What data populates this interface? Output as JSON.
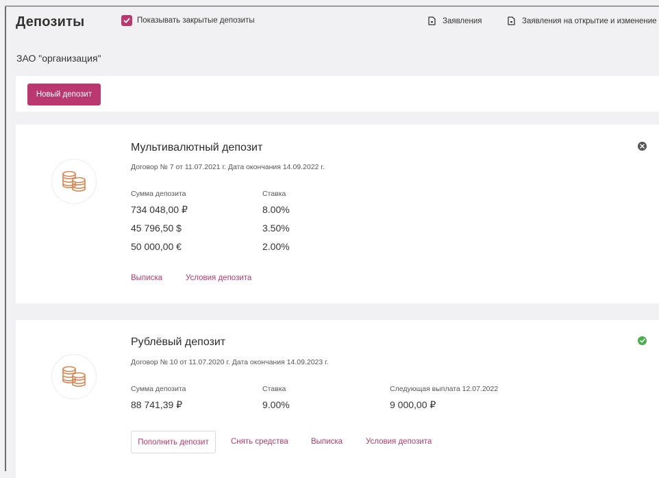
{
  "header": {
    "title": "Депозиты",
    "show_closed_label": "Показывать закрытые депозиты",
    "show_closed_checked": true,
    "link_statements": "Заявления",
    "link_open_change": "Заявления на открытие и изменение"
  },
  "organization": "ЗАО \"организация\"",
  "toolbar": {
    "new_deposit_label": "Новый депозит"
  },
  "colors": {
    "accent": "#b8386f",
    "closed_status": "#555555",
    "active_status": "#4caf50",
    "coins": "#d9844f"
  },
  "deposits": [
    {
      "title": "Мультивалютный депозит",
      "contract": "Договор № 7 от 11.07.2021 г. Дата окончания 14.09.2022 г.",
      "status_icon": "close-circle-icon",
      "amount_header": "Сумма депозита",
      "rate_header": "Ставка",
      "rows": [
        {
          "amount": "734 048,00 ₽",
          "rate": "8.00%"
        },
        {
          "amount": "45 796,50 $",
          "rate": "3.50%"
        },
        {
          "amount": "50 000,00 €",
          "rate": "2.00%"
        }
      ],
      "links": [
        "Выписка",
        "Условия депозита"
      ]
    },
    {
      "title": "Рублёвый депозит",
      "contract": "Договор № 10 от 11.07.2020 г. Дата окончания 14.09.2023 г.",
      "status_icon": "check-circle-icon",
      "amount_header": "Сумма депозита",
      "rate_header": "Ставка",
      "next_payout_header": "Следующая выплата 12.07.2022",
      "rows": [
        {
          "amount": "88 741,39 ₽",
          "rate": "9.00%",
          "next_payout": "9 000,00 ₽"
        }
      ],
      "action_button": "Пополнить депозит",
      "links": [
        "Снять средства",
        "Выписка",
        "Условия депозита"
      ]
    }
  ]
}
